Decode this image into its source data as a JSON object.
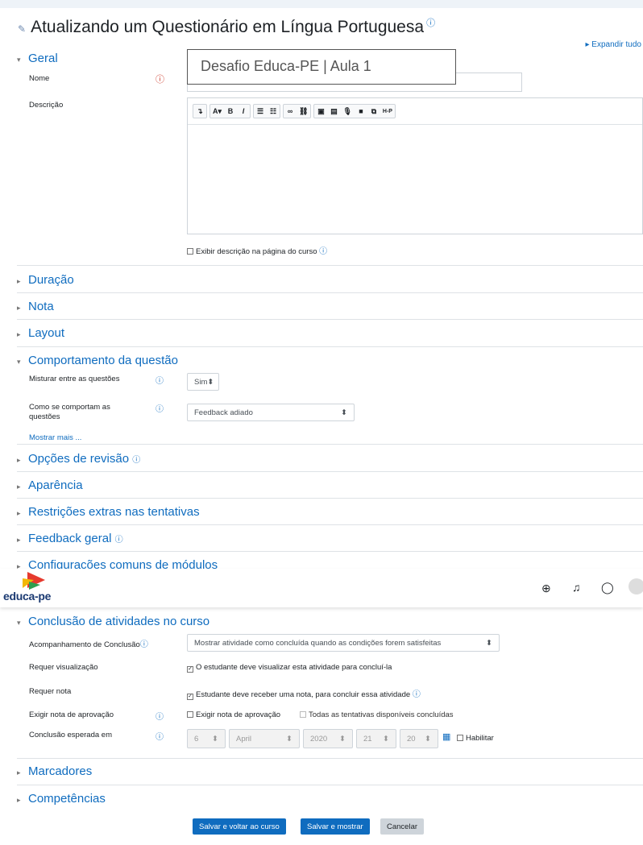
{
  "page": {
    "title": "Atualizando um Questionário em Língua Portuguesa",
    "expand_all": "Expandir tudo",
    "overlay_text": "Desafio Educa-PE | Aula 1"
  },
  "general": {
    "heading": "Geral",
    "name_label": "Nome",
    "description_label": "Descrição",
    "editor_toolbar": [
      "↴",
      "A▾",
      "B",
      "I",
      "☰",
      "☷",
      "∞",
      "⛓",
      "▣",
      "▤",
      "🎙",
      "■",
      "⧉",
      "H-P"
    ],
    "show_description": "Exibir descrição na página do curso"
  },
  "collapsed_sections": {
    "duration": "Duração",
    "grade": "Nota",
    "layout": "Layout"
  },
  "question_behaviour": {
    "heading": "Comportamento da questão",
    "shuffle_label": "Misturar entre as questões",
    "shuffle_value": "Sim",
    "behave_label": "Como se comportam as questões",
    "behave_value": "Feedback adiado",
    "show_more": "Mostrar mais ..."
  },
  "more_sections": {
    "review": "Opções de revisão",
    "appearance": "Aparência",
    "restrictions": "Restrições extras nas tentativas",
    "feedback": "Feedback geral",
    "common": "Configurações comuns de módulos"
  },
  "header": {
    "logo_text": "educa-pe",
    "icons": [
      "globe-icon",
      "bell-icon",
      "chat-icon",
      "avatar"
    ]
  },
  "completion": {
    "heading": "Conclusão de atividades no curso",
    "tracking_label": "Acompanhamento de Conclusão",
    "tracking_value": "Mostrar atividade como concluída quando as condições forem satisfeitas",
    "require_view_label": "Requer visualização",
    "require_view_text": "O estudante deve visualizar esta atividade para concluí-la",
    "require_grade_label": "Requer nota",
    "require_grade_text": "Estudante deve receber uma nota, para concluir essa atividade",
    "pass_grade_label": "Exigir nota de aprovação",
    "pass_grade_text": "Exigir nota de aprovação",
    "all_attempts_text": "Todas as tentativas disponíveis concluídas",
    "expected_label": "Conclusão esperada em",
    "day": "6",
    "month": "April",
    "year": "2020",
    "hour": "21",
    "minute": "20",
    "enable_text": "Habilitar"
  },
  "bottom_sections": {
    "tags": "Marcadores",
    "competencies": "Competências"
  },
  "buttons": {
    "save_return": "Salvar e voltar ao curso",
    "save_display": "Salvar e mostrar",
    "cancel": "Cancelar"
  },
  "colors": {
    "link": "#0f6cbf",
    "primary_button": "#0f6cbf",
    "required": "#ca3120"
  }
}
